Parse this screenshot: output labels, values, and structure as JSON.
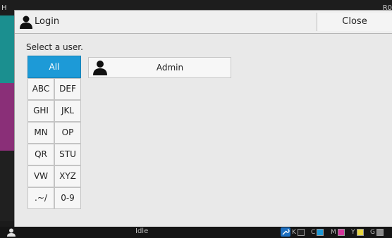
{
  "background": {
    "left_edge_text": "H",
    "right_edge_text": "R0"
  },
  "dialog": {
    "title": "Login",
    "close_label": "Close",
    "prompt": "Select a user."
  },
  "filters": {
    "all_label": "All",
    "groups": [
      "ABC",
      "DEF",
      "GHI",
      "JKL",
      "MN",
      "OP",
      "QR",
      "STU",
      "VW",
      "XYZ",
      ".~/",
      "0-9"
    ]
  },
  "users": [
    {
      "name": "Admin",
      "icon": "person-icon"
    }
  ],
  "status_bar": {
    "state_text": "Idle",
    "toner": [
      {
        "label": "K",
        "color": "#ffffff"
      },
      {
        "label": "C",
        "color": "#1d9ad7"
      },
      {
        "label": "M",
        "color": "#d4359b"
      },
      {
        "label": "Y",
        "color": "#e8d640"
      },
      {
        "label": "G",
        "color": "#8a8a8a"
      }
    ]
  },
  "colors": {
    "accent": "#1d9ad7",
    "bg_teal": "#1b8f8f",
    "bg_purple": "#8a2f78"
  }
}
